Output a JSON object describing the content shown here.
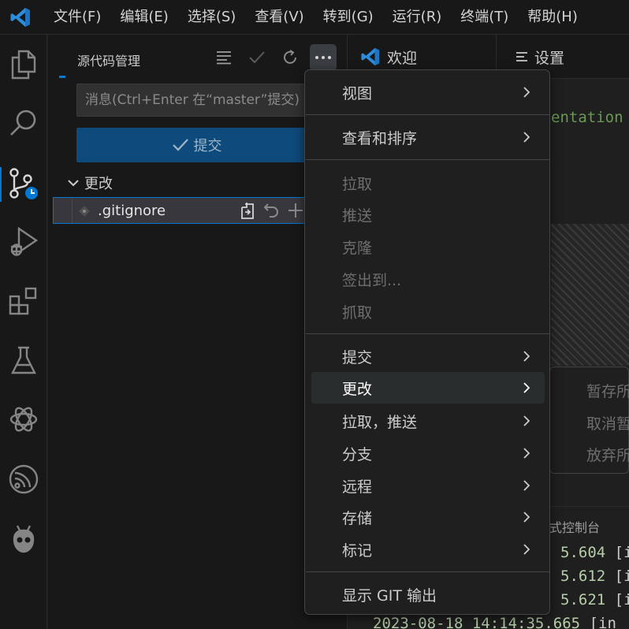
{
  "menubar": {
    "items": [
      "文件(F)",
      "编辑(E)",
      "选择(S)",
      "查看(V)",
      "转到(G)",
      "运行(R)",
      "终端(T)",
      "帮助(H)"
    ]
  },
  "activity_bar": {
    "icons": [
      "explorer-icon",
      "search-icon",
      "source-control-icon",
      "run-debug-icon",
      "extensions-icon",
      "testing-icon",
      "openai-icon",
      "espressif-icon",
      "platformio-icon"
    ],
    "accent": "#0078d4"
  },
  "scm": {
    "title": "源代码管理",
    "commit_placeholder": "消息(Ctrl+Enter 在“master”提交)",
    "commit_button": "提交",
    "changes_label": "更改",
    "files": [
      {
        "name": ".gitignore"
      }
    ]
  },
  "editor": {
    "tabs": [
      {
        "label": "欢迎",
        "icon": "vscode-icon"
      },
      {
        "label": "设置",
        "icon": "settings-editor-icon"
      }
    ],
    "code_fragment": "entation",
    "submenu_items": [
      "暂存所",
      "取消暂",
      "放弃所"
    ],
    "panel_tab": "式控制台",
    "log_lines": [
      {
        "text": "5.604",
        "bracket": "[in"
      },
      {
        "text": "5.612",
        "bracket": "[in"
      },
      {
        "text": "5.621",
        "bracket": "[in"
      },
      {
        "text": "2023-08-18 14:14:35.665",
        "bracket": "[in"
      }
    ]
  },
  "context_menu": {
    "items": [
      {
        "label": "视图",
        "submenu": true,
        "disabled": false
      },
      {
        "label": "查看和排序",
        "submenu": true,
        "disabled": false
      },
      {
        "label": "拉取",
        "submenu": false,
        "disabled": true
      },
      {
        "label": "推送",
        "submenu": false,
        "disabled": true
      },
      {
        "label": "克隆",
        "submenu": false,
        "disabled": true
      },
      {
        "label": "签出到...",
        "submenu": false,
        "disabled": true
      },
      {
        "label": "抓取",
        "submenu": false,
        "disabled": true
      },
      {
        "label": "提交",
        "submenu": true,
        "disabled": false
      },
      {
        "label": "更改",
        "submenu": true,
        "disabled": false,
        "highlighted": true
      },
      {
        "label": "拉取，推送",
        "submenu": true,
        "disabled": false
      },
      {
        "label": "分支",
        "submenu": true,
        "disabled": false
      },
      {
        "label": "远程",
        "submenu": true,
        "disabled": false
      },
      {
        "label": "存储",
        "submenu": true,
        "disabled": false
      },
      {
        "label": "标记",
        "submenu": true,
        "disabled": false
      },
      {
        "label": "显示 GIT 输出",
        "submenu": false,
        "disabled": false
      }
    ]
  }
}
